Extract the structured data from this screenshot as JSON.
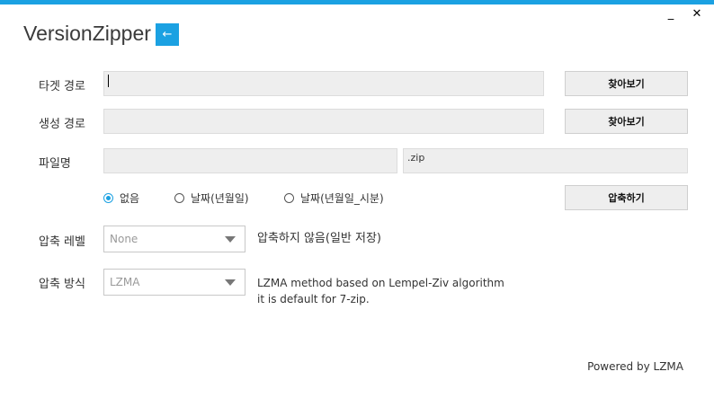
{
  "window": {
    "minimize_label": "_",
    "close_label": "✕",
    "accent": "#1ba1e2"
  },
  "header": {
    "title": "VersionZipper",
    "back_label": "←"
  },
  "target_path": {
    "label": "타겟 경로",
    "value": "",
    "browse_label": "찾아보기"
  },
  "output_path": {
    "label": "생성 경로",
    "value": "",
    "browse_label": "찾아보기"
  },
  "filename": {
    "label": "파일명",
    "value": "",
    "extension": ".zip"
  },
  "suffix_options": {
    "options": [
      "없음",
      "날짜(년월일)",
      "날짜(년월일_시분)"
    ],
    "selected": "없음"
  },
  "compress_button_label": "압축하기",
  "compression_level": {
    "label": "압축 레벨",
    "selected": "None",
    "description": "압축하지 않음(일반 저장)"
  },
  "compression_method": {
    "label": "압축 방식",
    "selected": "LZMA",
    "description_line1": "LZMA method based on Lempel-Ziv algorithm",
    "description_line2": "it is default for 7-zip."
  },
  "footer": {
    "powered_by": "Powered by LZMA"
  }
}
